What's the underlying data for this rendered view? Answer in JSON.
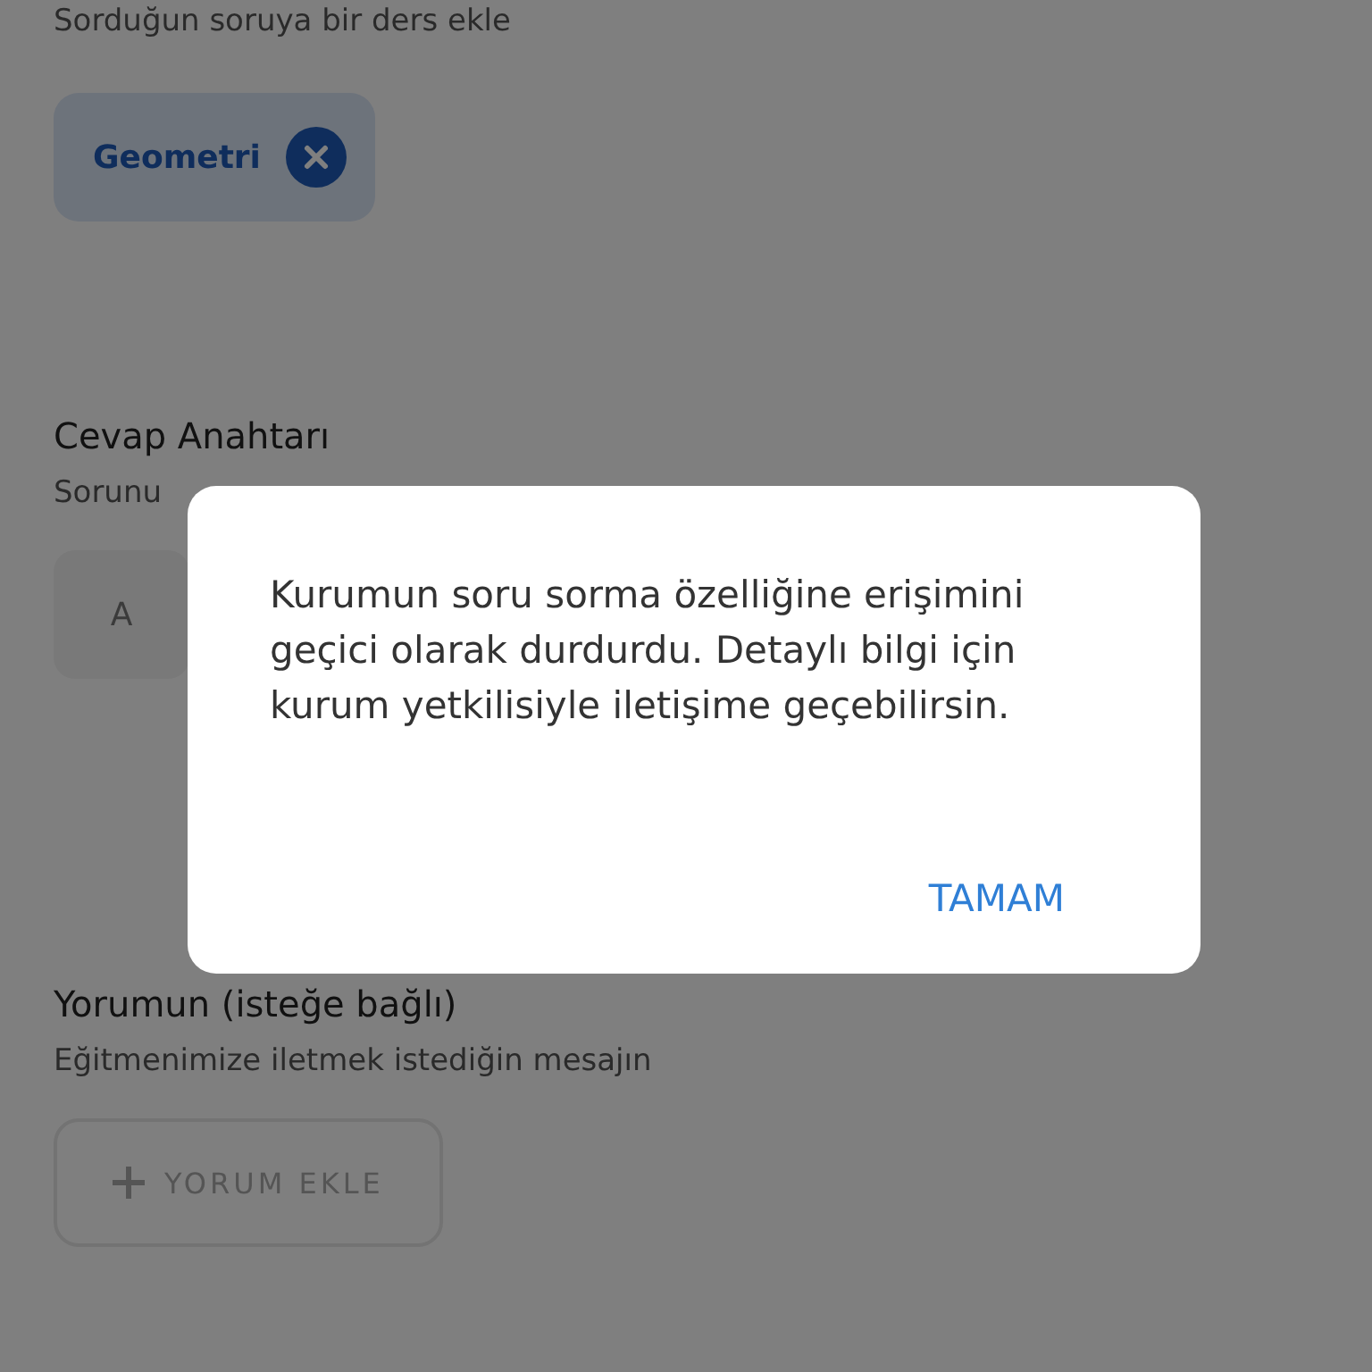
{
  "subject_section": {
    "hint": "Sorduğun soruya bir ders ekle",
    "chips": [
      {
        "label": "Geometri"
      }
    ]
  },
  "answer_key": {
    "title": "Cevap Anahtarı",
    "hint": "Sorunu",
    "options": [
      {
        "label": "A"
      }
    ]
  },
  "comment": {
    "title": "Yorumun (isteğe bağlı)",
    "hint": "Eğitmenimize iletmek istediğin mesajın",
    "button": "YORUM EKLE"
  },
  "dialog": {
    "message": "Kurumun soru sorma özelliğine erişimini geçici olarak durdurdu. Detaylı bilgi için kurum yetkilisiyle iletişime geçebilirsin.",
    "button": "TAMAM"
  }
}
